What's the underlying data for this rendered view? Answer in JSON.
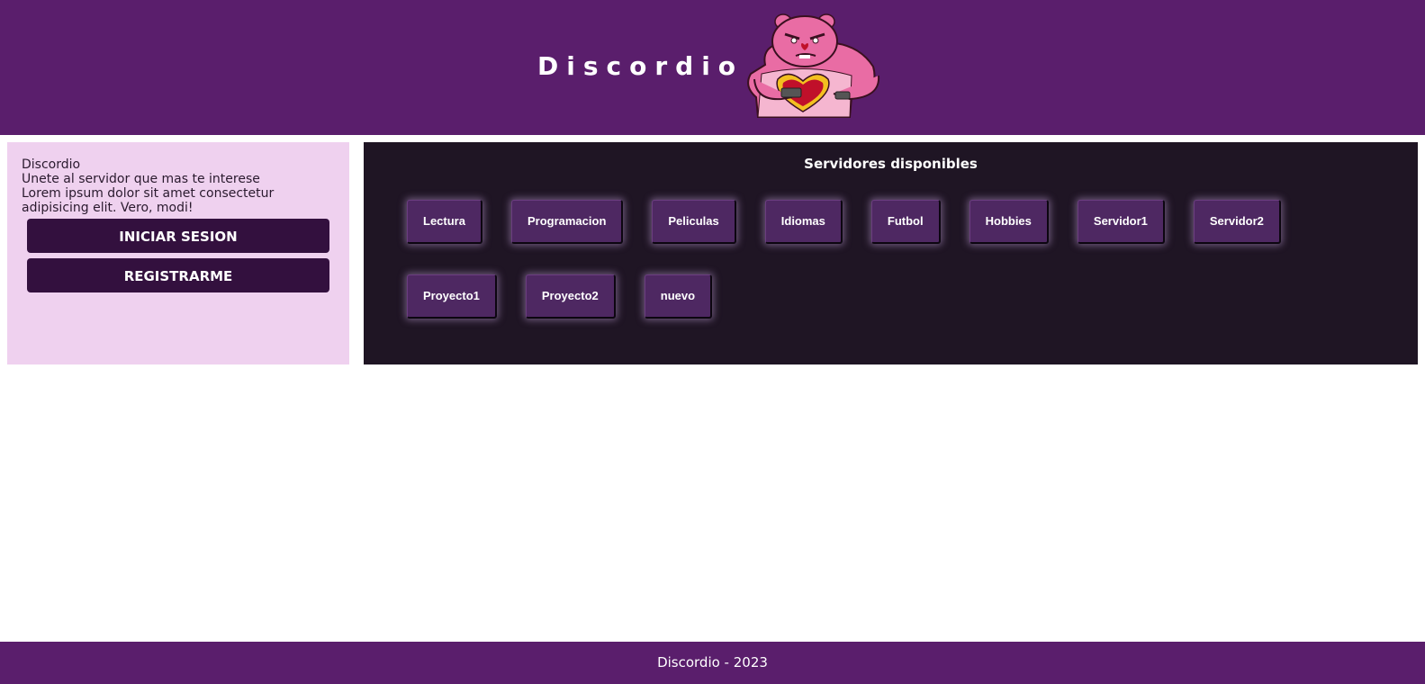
{
  "header": {
    "brand_title": "Discordio",
    "mascot_icon": "angry-pink-bear-icon",
    "background_color": "#5a1e6c"
  },
  "sidebar": {
    "lines": [
      "Discordio",
      "Unete al servidor que mas te interese",
      "Lorem ipsum dolor sit amet consectetur",
      "adipisicing elit. Vero, modi!"
    ],
    "login_label": "INICIAR SESION",
    "register_label": "REGISTRARME",
    "background_color": "#efd1ef",
    "button_color": "#33103e"
  },
  "servers": {
    "title": "Servidores disponibles",
    "items": [
      "Lectura",
      "Programacion",
      "Peliculas",
      "Idiomas",
      "Futbol",
      "Hobbies",
      "Servidor1",
      "Servidor2",
      "Proyecto1",
      "Proyecto2",
      "nuevo"
    ],
    "panel_color": "#1f1524",
    "button_color": "#4e2862"
  },
  "footer": {
    "text": "Discordio - 2023"
  }
}
